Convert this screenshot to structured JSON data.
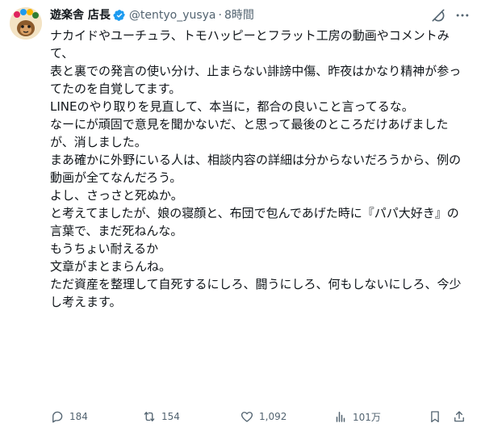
{
  "author": {
    "name": "遊楽舎 店長",
    "handle": "@tentyo_yusya",
    "separator": "·",
    "time": "8時間"
  },
  "tweet_lines": [
    "ナカイドやユーチュラ、トモハッピーとフラット工房の動画やコメントみて、",
    "",
    "表と裏での発言の使い分け、止まらない誹謗中傷、昨夜はかなり精神が参ってたのを自覚してます。",
    "LINEのやり取りを見直して、本当に，都合の良いこと言ってるな。",
    "なーにが頑固で意見を聞かないだ、と思って最後のところだけあげましたが、消しました。",
    "",
    "まあ確かに外野にいる人は、相談内容の詳細は分からないだろうから、例の動画が全てなんだろう。",
    "",
    "よし、さっさと死ぬか。",
    "",
    "と考えてましたが、娘の寝顔と、布団で包んであげた時に『パパ大好き』の言葉で、まだ死ねんな。",
    "",
    "もうちょい耐えるか",
    "",
    "文章がまとまらんね。",
    "ただ資産を整理して自死するにしろ、闘うにしろ、何もしないにしろ、今少し考えます。"
  ],
  "actions": {
    "reply_count": "184",
    "repost_count": "154",
    "like_count": "1,092",
    "views_count": "101万"
  },
  "colors": {
    "text": "#0f1419",
    "secondary": "#536471",
    "verified": "#1d9bf0"
  },
  "icons": [
    "verified-badge-icon",
    "grok-icon",
    "more-icon",
    "reply-icon",
    "repost-icon",
    "like-icon",
    "views-icon",
    "bookmark-icon",
    "share-icon"
  ]
}
